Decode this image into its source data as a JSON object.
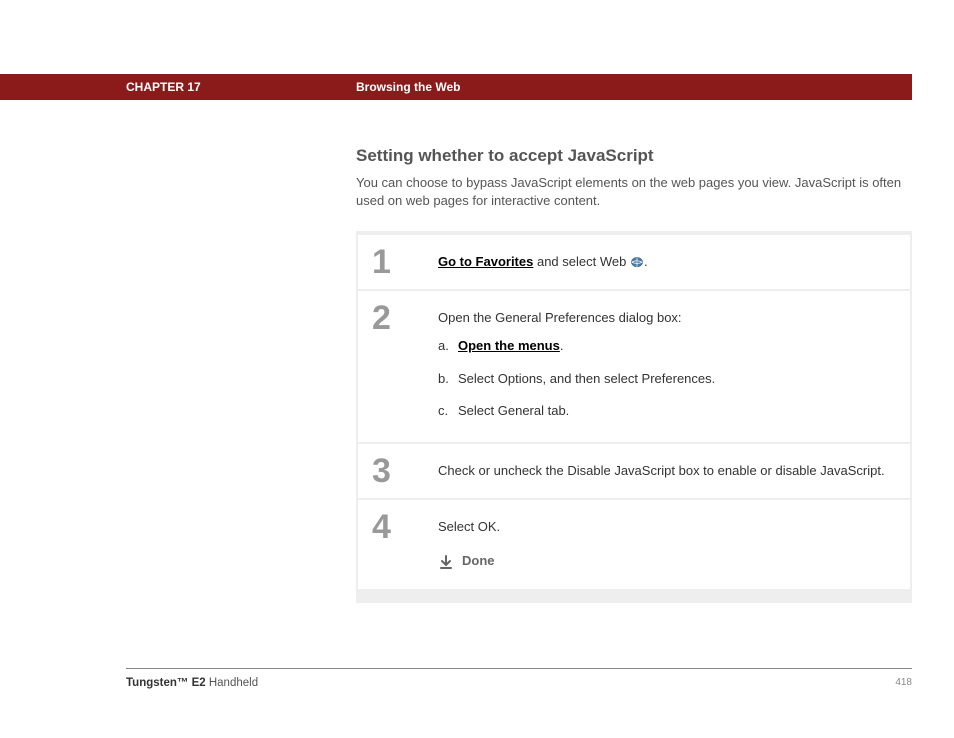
{
  "header": {
    "chapter": "CHAPTER 17",
    "breadcrumb": "Browsing the Web"
  },
  "section": {
    "title": "Setting whether to accept JavaScript",
    "intro": "You can choose to bypass JavaScript elements on the web pages you view. JavaScript is often used on web pages for interactive content."
  },
  "steps": {
    "s1": {
      "num": "1",
      "link": "Go to Favorites",
      "after": " and select Web ",
      "period": "."
    },
    "s2": {
      "num": "2",
      "lead": "Open the General Preferences dialog box:",
      "a_letter": "a.",
      "a_link": "Open the menus",
      "a_after": ".",
      "b_letter": "b.",
      "b_text": "Select Options, and then select Preferences.",
      "c_letter": "c.",
      "c_text": "Select General tab."
    },
    "s3": {
      "num": "3",
      "text": "Check or uncheck the Disable JavaScript box to enable or disable JavaScript."
    },
    "s4": {
      "num": "4",
      "text": "Select OK.",
      "done": "Done"
    }
  },
  "footer": {
    "product_bold": "Tungsten™ E2",
    "product_rest": " Handheld",
    "page": "418"
  }
}
